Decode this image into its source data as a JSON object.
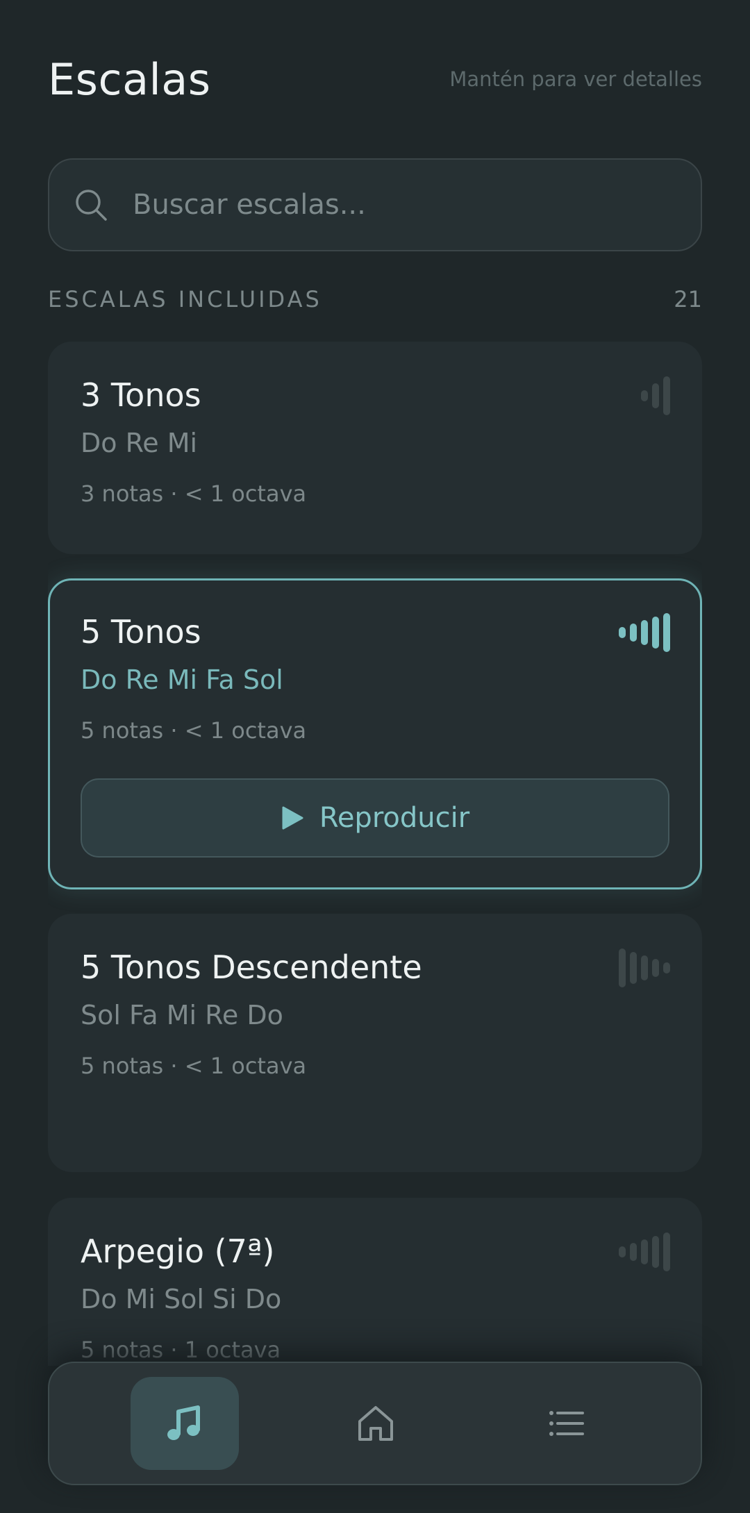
{
  "header": {
    "title": "Escalas",
    "hint": "Mantén para ver detalles"
  },
  "search": {
    "placeholder": "Buscar escalas..."
  },
  "section": {
    "label": "ESCALAS INCLUIDAS",
    "count": "21"
  },
  "scales": [
    {
      "title": "3 Tonos",
      "notes": "Do Re Mi",
      "meta": "3 notas · < 1 octava",
      "selected": false,
      "icon": "ascending-bars-icon"
    },
    {
      "title": "5 Tonos",
      "notes": "Do Re Mi Fa Sol",
      "meta": "5 notas · < 1 octava",
      "selected": true,
      "play_label": "Reproducir",
      "icon": "ascending-bars-icon"
    },
    {
      "title": "5 Tonos Descendente",
      "notes": "Sol Fa Mi Re Do",
      "meta": "5 notas · < 1 octava",
      "selected": false,
      "icon": "descending-bars-icon"
    },
    {
      "title": "Arpegio (7ª)",
      "notes": "Do Mi Sol Si Do",
      "meta": "5 notas · 1 octava",
      "selected": false,
      "icon": "ascending-bars-icon"
    }
  ],
  "nav": {
    "items": [
      {
        "icon": "music-note-icon",
        "active": true
      },
      {
        "icon": "home-icon",
        "active": false
      },
      {
        "icon": "list-icon",
        "active": false
      }
    ]
  },
  "colors": {
    "background": "#1f2729",
    "card": "#252e31",
    "accent": "#7cc0c2",
    "muted_text": "#7f8a8c"
  }
}
